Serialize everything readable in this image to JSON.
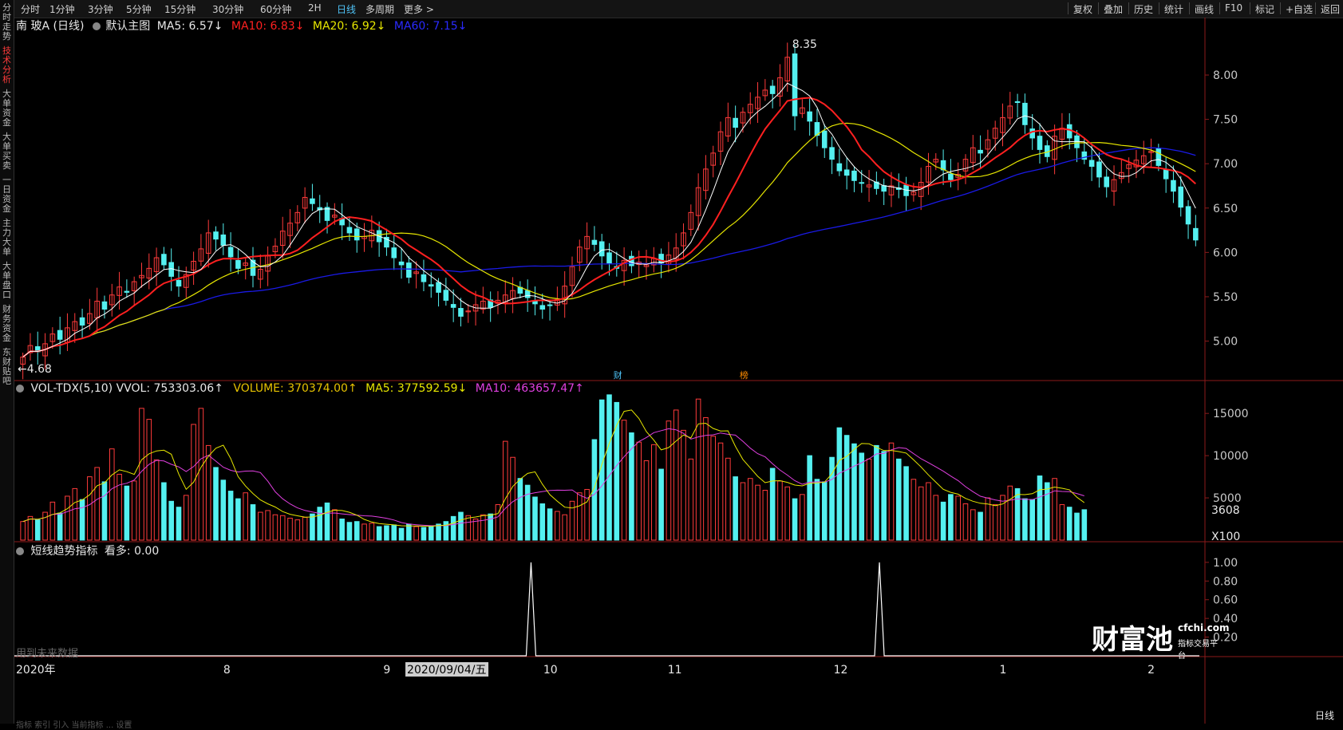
{
  "colors": {
    "up": "#ff3b3b",
    "down": "#54f0f0",
    "ma5": "#ffffff",
    "ma10": "#ff2020",
    "ma20": "#e6e600",
    "ma60": "#1a1ae6",
    "vol_ma5": "#e6e600",
    "vol_ma10": "#e040e0",
    "tab_active": "#4fc3f7",
    "nav_active": "#ff3b3b"
  },
  "toolbar": {
    "period_tabs": [
      "分时",
      "1分钟",
      "3分钟",
      "5分钟",
      "15分钟",
      "30分钟",
      "60分钟",
      "2H",
      "日线",
      "多周期",
      "更多"
    ],
    "active_tab": "日线",
    "right_buttons": [
      "复权",
      "叠加",
      "历史",
      "统计",
      "画线",
      "F10",
      "标记",
      "+自选",
      "返回"
    ]
  },
  "left_nav": [
    {
      "label": "分时走势",
      "active": false
    },
    {
      "label": "技术分析",
      "active": true
    },
    {
      "label": "大单资金",
      "active": false
    },
    {
      "label": "大单买卖",
      "active": false
    },
    {
      "label": "一日资金",
      "active": false
    },
    {
      "label": "主力大单",
      "active": false
    },
    {
      "label": "大单盘口",
      "active": false
    },
    {
      "label": "财务资金",
      "active": false
    },
    {
      "label": "东财贴吧",
      "active": false
    }
  ],
  "main_header": {
    "stock": "南 玻A (日线)",
    "indicator": "默认主图",
    "ma5": "MA5: 6.57↓",
    "ma10": "MA10: 6.83↓",
    "ma20": "MA20: 6.92↓",
    "ma60": "MA60: 7.15↓"
  },
  "main_annotations": {
    "high": "8.35",
    "low": "4.68",
    "marker_cai": "财",
    "marker_bang": "榜"
  },
  "volume_header": {
    "name": "VOL-TDX(5,10)",
    "vvol": "VVOL: 753303.06↑",
    "volume": "VOLUME: 370374.00↑",
    "ma5": "MA5: 377592.59↓",
    "ma10": "MA10: 463657.47↑"
  },
  "volume_current_label": "3608",
  "volume_unit": "X100",
  "trend_header": {
    "name": "短线趋势指标",
    "value": "看多: 0.00"
  },
  "trend_note": "用到未来数据",
  "watermark": {
    "brand": "财富池",
    "site": "cfchi.com",
    "tagline": "指标交易平台"
  },
  "bottom_right_label": "日线",
  "status_text": "指标 索引 引入 当前指标 ... 设置",
  "chart_data": {
    "type": "candlestick",
    "x_labels": [
      "2020年",
      "8",
      "9",
      "2020/09/04/五",
      "10",
      "11",
      "12",
      "1",
      "2"
    ],
    "price_axis": {
      "ticks": [
        "8.00",
        "7.50",
        "7.00",
        "6.50",
        "6.00",
        "5.50",
        "5.00"
      ],
      "range": [
        4.6,
        8.45
      ]
    },
    "volume_axis": {
      "ticks": [
        "15000",
        "10000",
        "5000"
      ],
      "range": [
        0,
        17000
      ]
    },
    "trend_axis": {
      "ticks": [
        "1.00",
        "0.80",
        "0.60",
        "0.40",
        "0.20"
      ],
      "range": [
        0,
        1.05
      ]
    },
    "close_price": [
      4.82,
      4.95,
      4.88,
      4.97,
      5.08,
      5.02,
      5.15,
      5.22,
      5.18,
      5.31,
      5.45,
      5.36,
      5.52,
      5.61,
      5.55,
      5.67,
      5.74,
      5.82,
      5.94,
      5.86,
      5.73,
      5.62,
      5.75,
      5.9,
      6.04,
      6.22,
      6.15,
      6.08,
      5.95,
      5.82,
      5.88,
      5.74,
      5.81,
      5.96,
      6.07,
      6.24,
      6.33,
      6.45,
      6.62,
      6.55,
      6.48,
      6.36,
      6.42,
      6.31,
      6.22,
      6.14,
      6.18,
      6.25,
      6.12,
      6.06,
      5.94,
      5.86,
      5.72,
      5.78,
      5.67,
      5.62,
      5.55,
      5.46,
      5.38,
      5.28,
      5.34,
      5.41,
      5.45,
      5.38,
      5.46,
      5.52,
      5.57,
      5.54,
      5.49,
      5.42,
      5.36,
      5.4,
      5.47,
      5.62,
      5.84,
      6.06,
      6.18,
      6.09,
      5.96,
      5.88,
      5.82,
      5.91,
      5.85,
      5.89,
      5.86,
      5.93,
      5.88,
      5.97,
      6.05,
      6.22,
      6.45,
      6.73,
      6.94,
      7.12,
      7.36,
      7.52,
      7.41,
      7.58,
      7.67,
      7.75,
      7.83,
      7.79,
      7.97,
      8.2,
      7.54,
      7.63,
      7.48,
      7.32,
      7.18,
      7.05,
      6.92,
      6.87,
      6.81,
      6.78,
      6.76,
      6.72,
      6.69,
      6.75,
      6.71,
      6.64,
      6.68,
      6.79,
      6.97,
      7.05,
      6.93,
      6.82,
      6.88,
      7.05,
      7.18,
      7.12,
      7.27,
      7.4,
      7.52,
      7.65,
      7.69,
      7.44,
      7.29,
      7.16,
      7.08,
      7.31,
      7.4,
      7.29,
      7.18,
      7.05,
      6.97,
      6.85,
      6.74,
      6.82,
      6.9,
      6.99,
      7.04,
      7.09,
      7.14,
      6.98,
      6.83,
      6.69,
      6.51,
      6.32,
      6.14
    ],
    "volume": [
      2200,
      2800,
      2400,
      3300,
      4500,
      3200,
      5200,
      6100,
      4800,
      7500,
      8600,
      6900,
      10800,
      7800,
      6400,
      7000,
      15600,
      14300,
      9500,
      6800,
      4600,
      3900,
      5300,
      13700,
      15600,
      11200,
      8600,
      7100,
      5800,
      4900,
      5600,
      4200,
      3300,
      3500,
      3000,
      2900,
      2600,
      2400,
      2700,
      3100,
      3900,
      4400,
      3600,
      2500,
      2100,
      2200,
      1900,
      2000,
      1600,
      1700,
      1800,
      1400,
      1900,
      1600,
      1500,
      1700,
      1900,
      2200,
      2800,
      3300,
      2900,
      2500,
      3000,
      3100,
      4200,
      11700,
      9800,
      7300,
      6500,
      5100,
      4300,
      3700,
      3400,
      3000,
      4600,
      5600,
      6000,
      11900,
      16600,
      17200,
      16300,
      14200,
      12700,
      11600,
      9400,
      11300,
      8400,
      14100,
      15400,
      13000,
      9600,
      16700,
      14500,
      12300,
      11500,
      9700,
      7500,
      6800,
      7300,
      6500,
      5900,
      8500,
      7000,
      6300,
      4900,
      5400,
      10000,
      7200,
      6900,
      9800,
      13300,
      12400,
      11400,
      10300,
      9600,
      11200,
      10500,
      11500,
      9600,
      8700,
      7200,
      6300,
      6800,
      5300,
      4500,
      5400,
      5200,
      4300,
      3600,
      3300,
      5000,
      4200,
      5300,
      6400,
      6100,
      4900,
      4800,
      7600,
      6800,
      7300,
      4200,
      3900,
      3200,
      3600
    ],
    "trend_signal_positions": [
      0.436,
      0.73
    ]
  }
}
